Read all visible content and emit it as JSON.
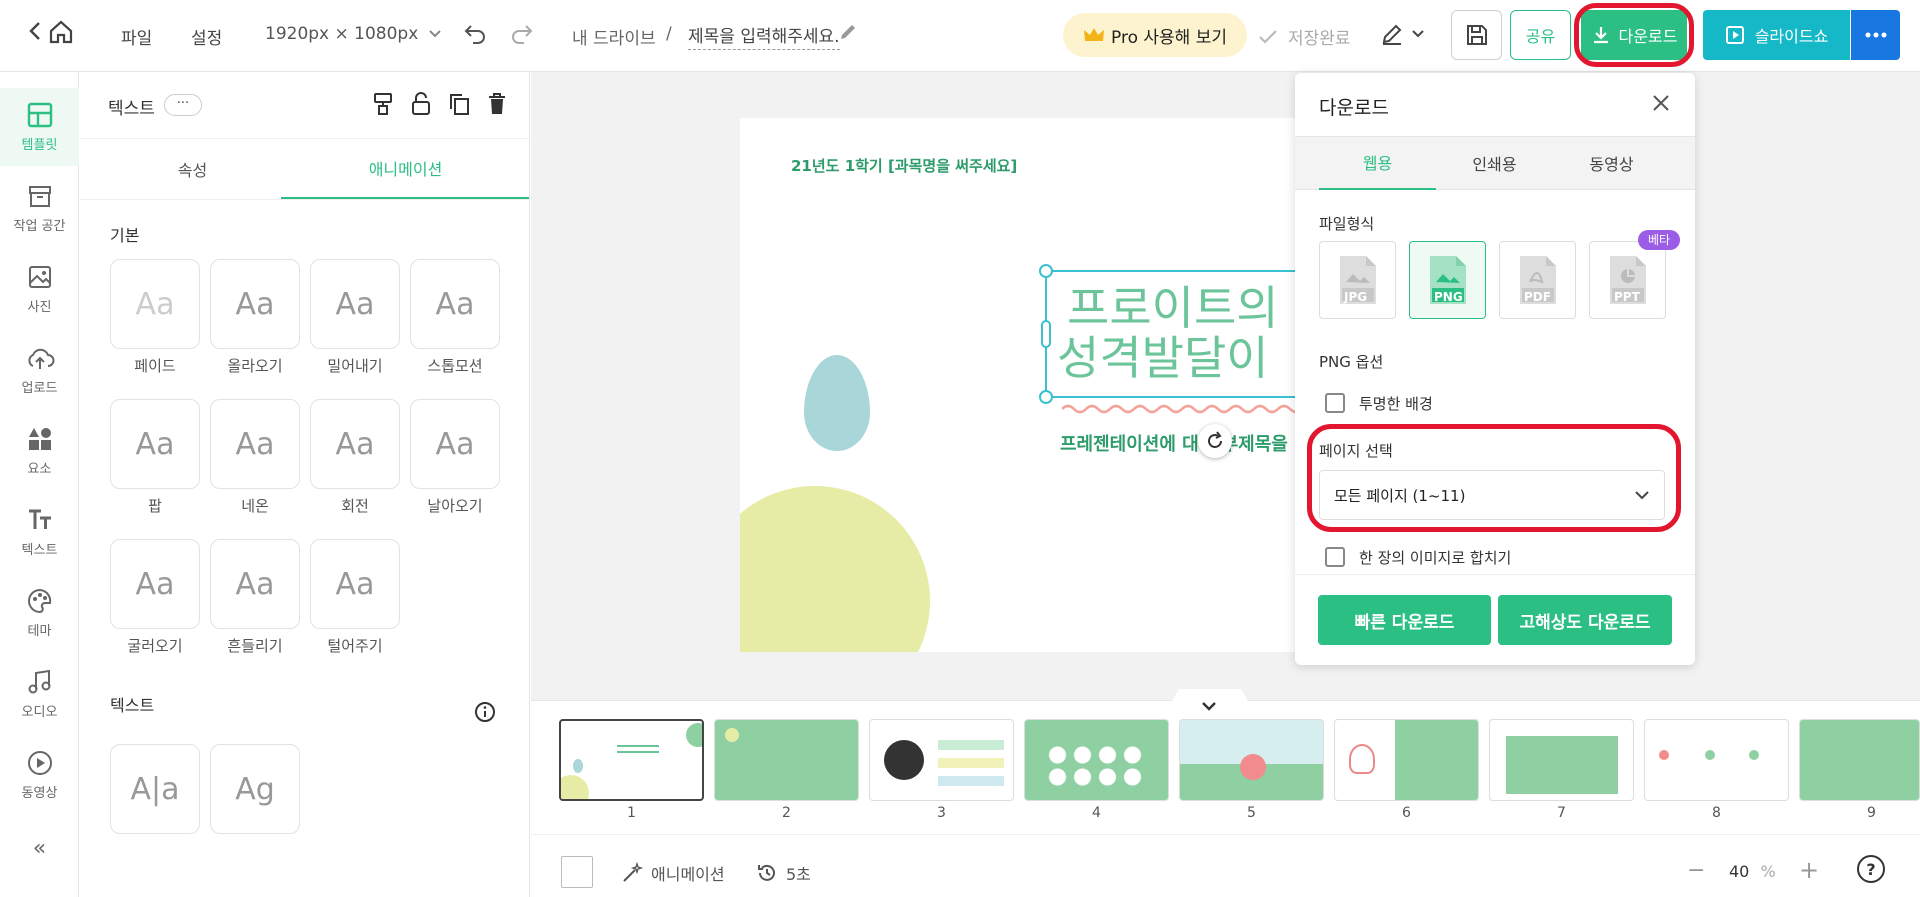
{
  "topbar": {
    "menu_file": "파일",
    "menu_settings": "설정",
    "canvas_size": "1920px × 1080px",
    "breadcrumb_drive": "내 드라이브",
    "breadcrumb_sep": "/",
    "doc_title_placeholder": "제목을 입력해주세요.",
    "pro_label": "Pro 사용해 보기",
    "save_status": "저장완료",
    "share_label": "공유",
    "download_label": "다운로드",
    "slideshow_label": "슬라이드쇼"
  },
  "rail": {
    "items": [
      {
        "label": "템플릿",
        "icon": "template-icon"
      },
      {
        "label": "작업 공간",
        "icon": "workspace-icon"
      },
      {
        "label": "사진",
        "icon": "photo-icon"
      },
      {
        "label": "업로드",
        "icon": "upload-icon"
      },
      {
        "label": "요소",
        "icon": "elements-icon"
      },
      {
        "label": "텍스트",
        "icon": "text-icon"
      },
      {
        "label": "테마",
        "icon": "theme-icon"
      },
      {
        "label": "오디오",
        "icon": "audio-icon"
      },
      {
        "label": "동영상",
        "icon": "video-icon"
      }
    ],
    "collapse_label": "«"
  },
  "panel": {
    "title": "텍스트",
    "more": "···",
    "tabs": [
      "속성",
      "애니메이션"
    ],
    "active_tab": 1,
    "section_basic": "기본",
    "animations": [
      {
        "label": "페이드",
        "glyph": "Aa"
      },
      {
        "label": "올라오기",
        "glyph": "Aa"
      },
      {
        "label": "밀어내기",
        "glyph": "Aa"
      },
      {
        "label": "스톱모션",
        "glyph": "Aa"
      },
      {
        "label": "팝",
        "glyph": "Aa"
      },
      {
        "label": "네온",
        "glyph": "Aa"
      },
      {
        "label": "회전",
        "glyph": "Aa"
      },
      {
        "label": "날아오기",
        "glyph": "Aa"
      },
      {
        "label": "굴러오기",
        "glyph": "Aa"
      },
      {
        "label": "흔들리기",
        "glyph": "Aa"
      },
      {
        "label": "털어주기",
        "glyph": "Aa"
      }
    ],
    "section_text": "텍스트",
    "text_cards": [
      "A|a",
      "Ag"
    ]
  },
  "slide": {
    "subtitle_top": "21년도 1학기 [과목명을 써주세요]",
    "title_line1": "프로이트의",
    "title_line2": "성격발달이",
    "tagline": "프레젠테이션에 대한 부제목을"
  },
  "download": {
    "title": "다운로드",
    "tabs": [
      "웹용",
      "인쇄용",
      "동영상"
    ],
    "active_tab": 0,
    "file_format_label": "파일형식",
    "formats": [
      "JPG",
      "PNG",
      "PDF",
      "PPT"
    ],
    "selected_format": "PNG",
    "beta_badge": "베타",
    "png_options_label": "PNG 옵션",
    "transparent_bg_label": "투명한 배경",
    "page_select_label": "페이지 선택",
    "page_select_value": "모든 페이지 (1~11)",
    "merge_label": "한 장의 이미지로 합치기",
    "quick_download": "빠른 다운로드",
    "hires_download": "고해상도 다운로드"
  },
  "filmstrip": {
    "pages": [
      "1",
      "2",
      "3",
      "4",
      "5",
      "6",
      "7",
      "8",
      "9"
    ]
  },
  "bottombar": {
    "animation_label": "애니메이션",
    "duration_label": "5초",
    "zoom_value": "40",
    "zoom_unit": "%",
    "help": "?"
  },
  "colors": {
    "accent_green": "#2cbf84",
    "teal": "#14b8c6",
    "highlight_red": "#e2162e",
    "slide_green": "#8fd0a2",
    "beta_purple": "#9b5de5"
  }
}
